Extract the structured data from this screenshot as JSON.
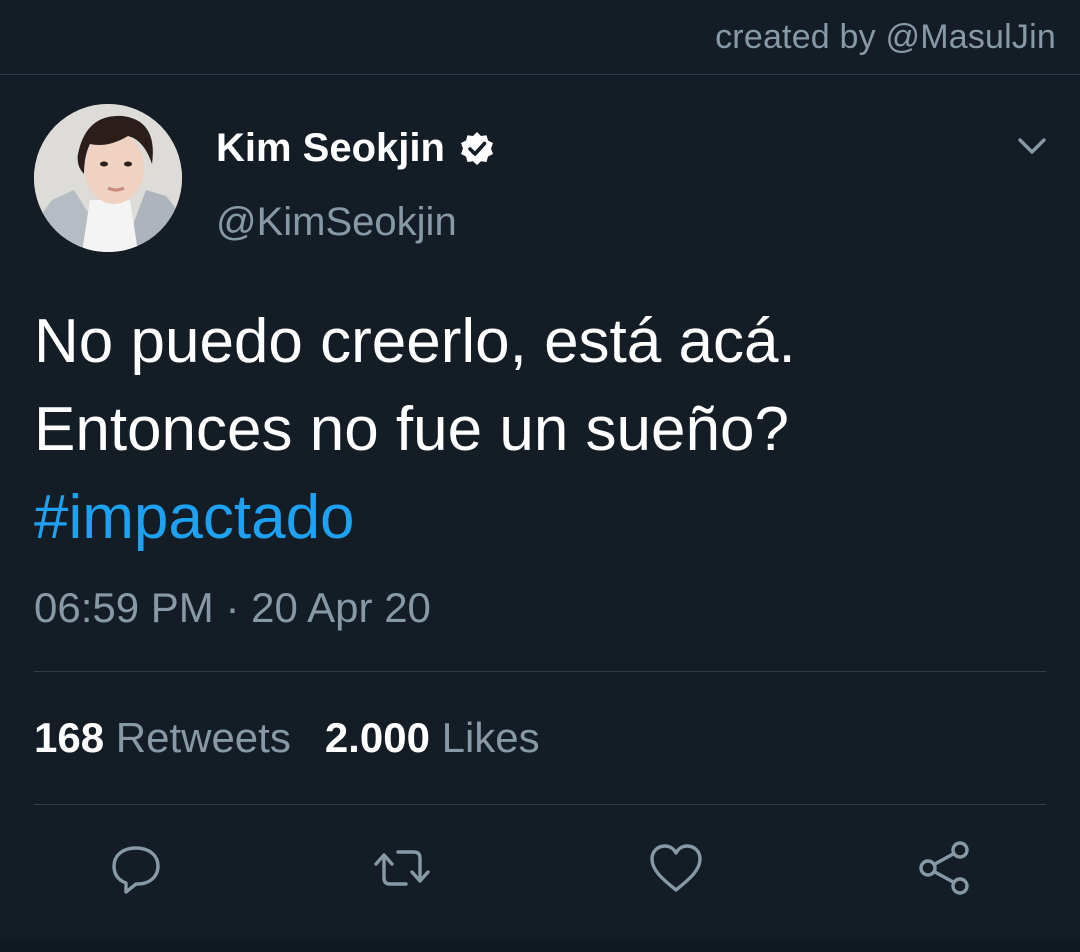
{
  "credit": "created by @MasulJin",
  "author": {
    "name": "Kim Seokjin",
    "handle": "@KimSeokjin",
    "verified": true
  },
  "tweet": {
    "lines": [
      "No puedo creerlo, está acá.",
      "Entonces no fue un sueño?"
    ],
    "hashtag": "#impactado",
    "timestamp": "06:59 PM · 20 Apr 20"
  },
  "stats": {
    "retweets_count": "168",
    "retweets_label": "Retweets",
    "likes_count": "2.000",
    "likes_label": "Likes"
  },
  "actions": {
    "reply_icon": "speech-bubble",
    "retweet_icon": "two-arrows-loop",
    "like_icon": "heart-outline",
    "share_icon": "share-nodes"
  },
  "colors": {
    "background": "#141d26",
    "text_primary": "#ffffff",
    "text_secondary": "#8899a6",
    "accent": "#1da1f2",
    "divider": "#2f3d4c"
  }
}
